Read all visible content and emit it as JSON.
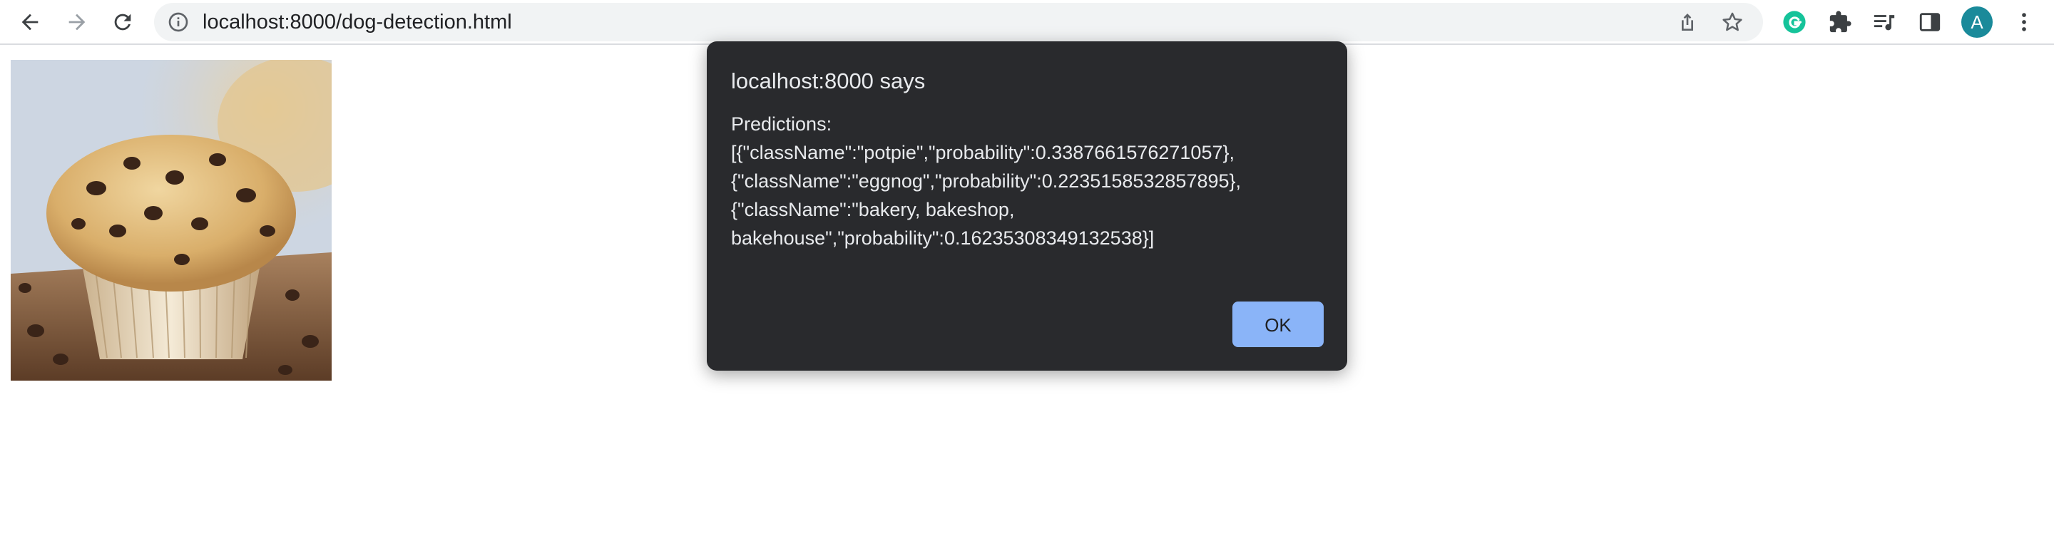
{
  "browser": {
    "url": "localhost:8000/dog-detection.html",
    "profile_initial": "A",
    "icons": [
      "back-arrow-icon",
      "forward-arrow-icon",
      "reload-icon",
      "info-icon",
      "share-icon",
      "star-icon",
      "grammarly-icon",
      "puzzle-extensions-icon",
      "media-queue-icon",
      "side-panel-icon",
      "kebab-menu-icon"
    ]
  },
  "page": {
    "image_subject": "chocolate chip muffin"
  },
  "dialog": {
    "title": "localhost:8000 says",
    "message": "Predictions:\n[{\"className\":\"potpie\",\"probability\":0.3387661576271057},\n{\"className\":\"eggnog\",\"probability\":0.2235158532857895},\n{\"className\":\"bakery, bakeshop,\nbakehouse\",\"probability\":0.16235308349132538}]",
    "ok_label": "OK"
  },
  "colors": {
    "dialog_bg": "#292a2d",
    "ok_button": "#8ab4f8",
    "avatar": "#1a8a9a"
  }
}
